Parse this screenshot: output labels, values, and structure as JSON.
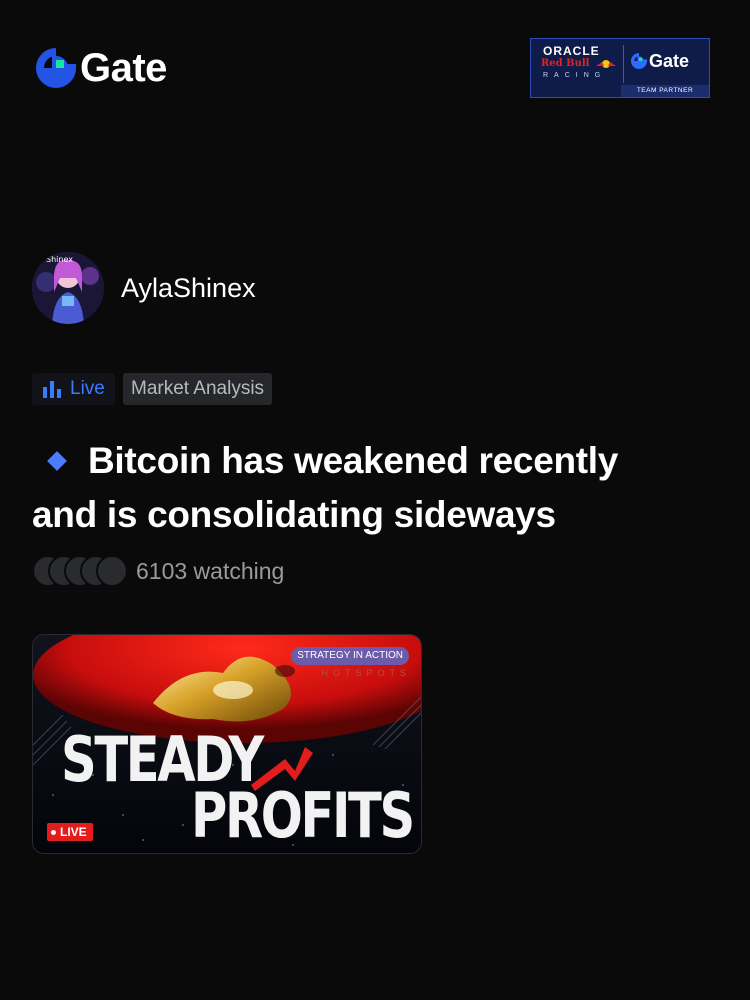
{
  "header": {
    "brand": "Gate",
    "partner": {
      "oracle": "ORACLE",
      "redbull": "Red Bull",
      "racing": "RACING",
      "gate": "Gate",
      "team_partner": "TEAM PARTNER"
    }
  },
  "author": {
    "name": "AylaShinex",
    "avatar_text": "Shinex"
  },
  "tags": {
    "live": "Live",
    "category": "Market Analysis"
  },
  "post": {
    "title": "Bitcoin has weakened recently and is consolidating sideways",
    "watching": "6103 watching"
  },
  "thumbnail": {
    "badge": "STRATEGY IN ACTION",
    "sub": "HOTSPOTS",
    "line1": "STEADY",
    "line2": "PROFITS",
    "live": "LIVE"
  },
  "colors": {
    "background": "#0a0a0b",
    "brand_blue": "#2354e6",
    "brand_green": "#17e6a1",
    "live_blue": "#3b7bff",
    "live_red": "#e31d1d"
  }
}
